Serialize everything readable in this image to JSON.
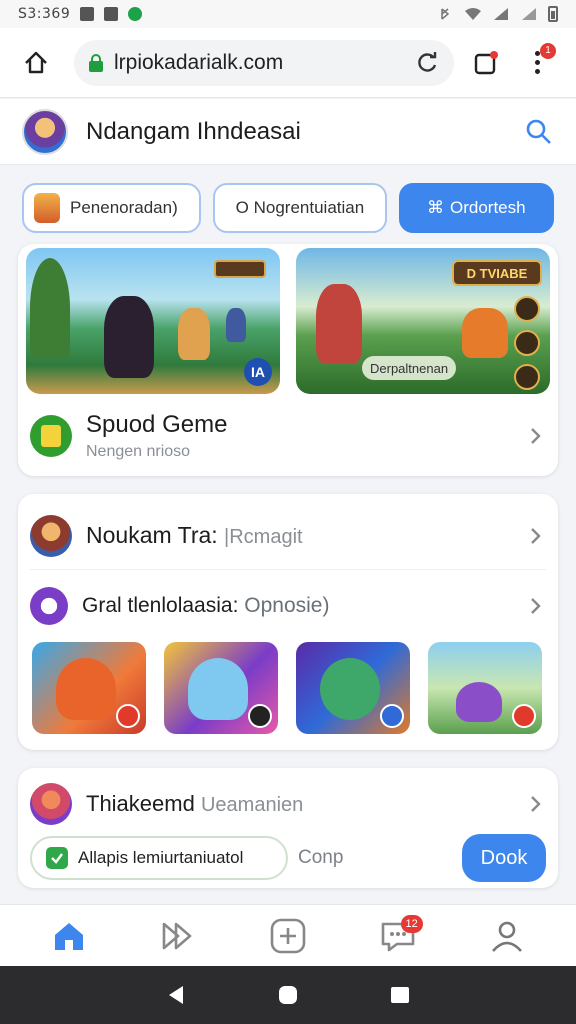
{
  "status_bar": {
    "time": "S3:369"
  },
  "browser": {
    "url": "lrpiokadarialk.com",
    "menu_badge": "1"
  },
  "header": {
    "title": "Ndangam Ihndeasai"
  },
  "chips": [
    {
      "label": "Penenoradan)"
    },
    {
      "label": "O Nogrentuiatian"
    },
    {
      "label": "Ordortesh",
      "glyph": "⌘"
    }
  ],
  "featured": {
    "banner_corner": "IA",
    "banner2_sign": "D TVIABE",
    "banner2_label": "Derpaltnenan",
    "game_name": "Spuod Geme",
    "game_sub": "Nengen nrioso"
  },
  "list": {
    "row1_title": "Noukam Tra:",
    "row1_muted": "|Rcmagit",
    "row2_title": "Gral tlenlolaasia:",
    "row2_muted": "Opnosie)"
  },
  "bottom_card": {
    "title": "Thiakeemd",
    "muted": "Ueamanien",
    "check_label": "Allapis lemiurtaniuatol",
    "comp_label": "Conp",
    "done_label": "Dook"
  },
  "bottom_nav": {
    "messages_badge": "12"
  },
  "colors": {
    "accent": "#3d86ee",
    "success": "#2fa84a",
    "alert": "#e53935"
  }
}
